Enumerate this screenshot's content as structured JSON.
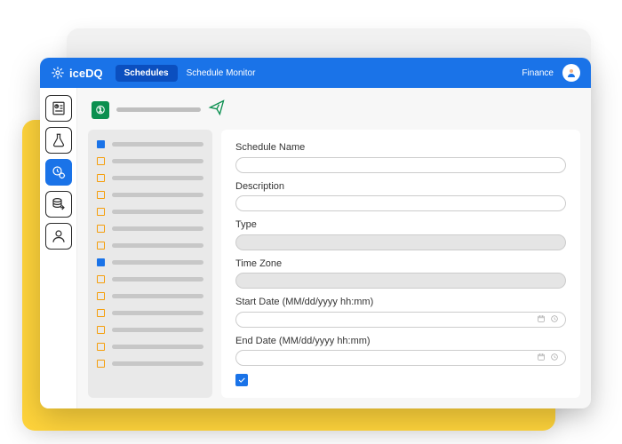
{
  "brand": {
    "name": "iceDQ"
  },
  "nav": {
    "active_tab": "Schedules",
    "tab2": "Schedule Monitor"
  },
  "workspace": {
    "name": "Finance"
  },
  "sidebar": {
    "items": [
      {
        "id": "reports"
      },
      {
        "id": "lab"
      },
      {
        "id": "schedules",
        "active": true
      },
      {
        "id": "data"
      },
      {
        "id": "users"
      }
    ]
  },
  "list": {
    "items": [
      {
        "color": "blue"
      },
      {
        "color": "orange"
      },
      {
        "color": "orange"
      },
      {
        "color": "orange"
      },
      {
        "color": "orange"
      },
      {
        "color": "orange"
      },
      {
        "color": "orange"
      },
      {
        "color": "blue"
      },
      {
        "color": "orange"
      },
      {
        "color": "orange"
      },
      {
        "color": "orange"
      },
      {
        "color": "orange"
      },
      {
        "color": "orange"
      },
      {
        "color": "orange"
      }
    ]
  },
  "form": {
    "schedule_name": {
      "label": "Schedule Name",
      "value": ""
    },
    "description": {
      "label": "Description",
      "value": ""
    },
    "type": {
      "label": "Type",
      "value": ""
    },
    "time_zone": {
      "label": "Time Zone",
      "value": ""
    },
    "start_date": {
      "label": "Start Date (MM/dd/yyyy hh:mm)",
      "value": ""
    },
    "end_date": {
      "label": "End Date (MM/dd/yyyy hh:mm)",
      "value": ""
    },
    "checkbox_checked": true
  }
}
